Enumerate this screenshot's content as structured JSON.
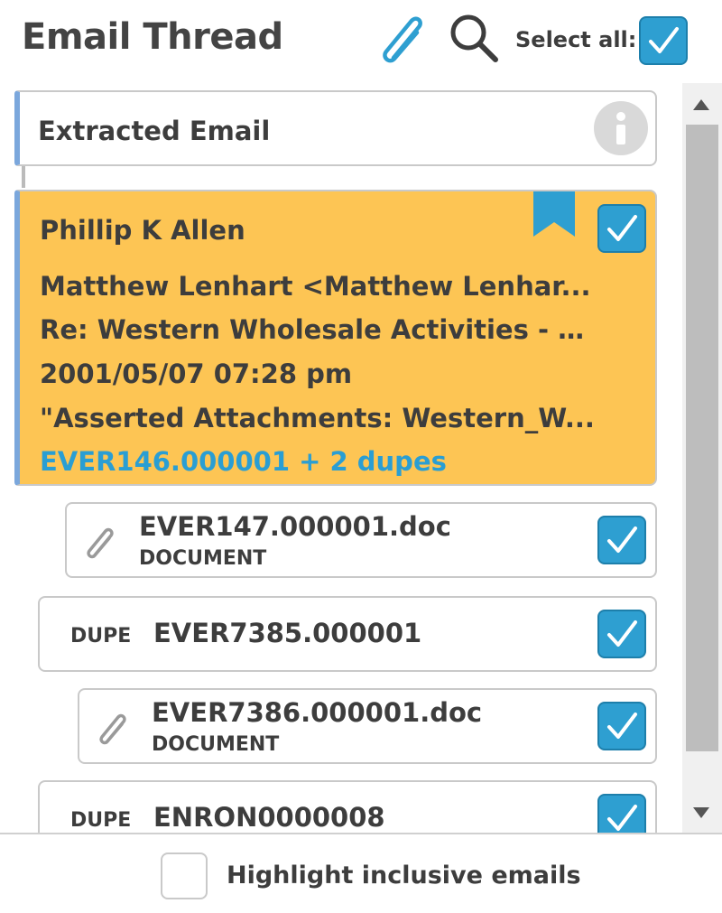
{
  "header": {
    "title": "Email Thread",
    "attachment_icon": "paperclip-icon",
    "search_icon": "search-icon",
    "select_all_label": "Select all:",
    "select_all_checked": true
  },
  "thread": {
    "extracted": {
      "label": "Extracted Email",
      "icon": "info-icon"
    },
    "email": {
      "from": "Phillip K Allen",
      "to": "Matthew Lenhart <Matthew Lenhar...",
      "subject": "Re: Western Wholesale Activities - G...",
      "date": "2001/05/07 07:28 pm",
      "attachments_note": "\"Asserted Attachments: Western_W...",
      "doc_link": "EVER146.000001 + 2 dupes",
      "bookmarked": true,
      "checked": true
    },
    "items": [
      {
        "kind": "attachment",
        "name": "EVER147.000001.doc",
        "type": "DOCUMENT",
        "checked": true
      },
      {
        "kind": "dupe",
        "tag": "DUPE",
        "id": "EVER7385.000001",
        "checked": true
      },
      {
        "kind": "attachment",
        "name": "EVER7386.000001.doc",
        "type": "DOCUMENT",
        "checked": true
      },
      {
        "kind": "dupe",
        "tag": "DUPE",
        "id": "ENRON0000008",
        "checked": true
      }
    ]
  },
  "footer": {
    "highlight_label": "Highlight inclusive emails",
    "highlight_checked": false
  },
  "colors": {
    "accent_blue": "#2e9fd1",
    "selected_card": "#fdc554",
    "thread_bar": "#7ba7dc",
    "link": "#2a9ed3"
  }
}
